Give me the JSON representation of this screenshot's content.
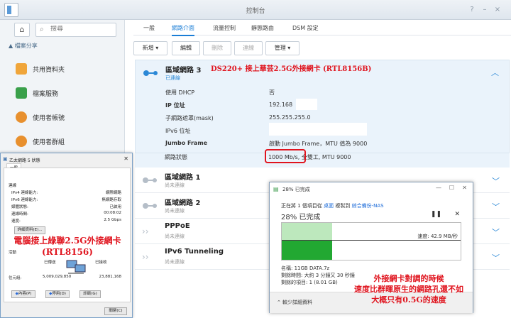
{
  "window": {
    "title": "控制台"
  },
  "sidebar": {
    "search_placeholder": "搜尋",
    "section_label": "檔案分享",
    "items": [
      {
        "label": "共用資料夾",
        "icon": "shared-folder-icon"
      },
      {
        "label": "檔案服務",
        "icon": "file-services-icon"
      },
      {
        "label": "使用者帳號",
        "icon": "user-icon"
      },
      {
        "label": "使用者群組",
        "icon": "group-icon"
      }
    ]
  },
  "tabs": [
    "一般",
    "網路介面",
    "流量控制",
    "靜態路由",
    "DSM 設定"
  ],
  "toolbar": {
    "new": "新增",
    "edit": "編輯",
    "delete": "刪除",
    "connect": "連線",
    "manage": "管理"
  },
  "lan3": {
    "name": "區域網路 3",
    "status": "已連線",
    "annotation": "DS220+ 接上華芸2.5G外接網卡 (RTL8156B)",
    "rows": [
      {
        "label": "使用 DHCP",
        "value": "否"
      },
      {
        "label": "IP 位址",
        "value": "192.168"
      },
      {
        "label": "子網路遮罩(mask)",
        "value": "255.255.255.0"
      },
      {
        "label": "IPv6 位址",
        "value": ""
      },
      {
        "label": "Jumbo Frame",
        "value": "啟動 Jumbo Frame，MTU 值為 9000"
      },
      {
        "label": "網路狀態",
        "value": "1000 Mb/s, 全雙工, MTU 9000"
      }
    ]
  },
  "interfaces": [
    {
      "name": "區域網路 1",
      "status": "尚未連線"
    },
    {
      "name": "區域網路 2",
      "status": "尚未連線"
    },
    {
      "name": "PPPoE",
      "status": "尚未連線"
    },
    {
      "name": "IPv6 Tunneling",
      "status": "尚未連線"
    }
  ],
  "eth_dialog": {
    "title": "乙太網路 5 狀態",
    "tab": "一般",
    "section_conn": "連線",
    "rows": [
      {
        "label": "IPv4 連線能力:",
        "value": "網際網路"
      },
      {
        "label": "IPv6 連線能力:",
        "value": "無網路存取"
      },
      {
        "label": "媒體狀態:",
        "value": "已啟用"
      },
      {
        "label": "連線時間:",
        "value": "00:08:02"
      },
      {
        "label": "速度:",
        "value": "2.5 Gbps"
      }
    ],
    "details_button": "詳細資料(E)...",
    "section_activity": "活動",
    "sent_label": "已傳送",
    "received_label": "已接收",
    "bytes_label": "位元組:",
    "bytes_sent": "5,009,029,850",
    "bytes_received": "23,881,168",
    "properties_button": "內容(P)",
    "disable_button": "停用(D)",
    "diagnose_button": "診斷(G)",
    "close_button": "關閉(C)",
    "annotation_line1": "電腦接上綠聯2.5G外接網卡",
    "annotation_line2": "(RTL8156)"
  },
  "copy_dialog": {
    "title": "28% 已完成",
    "copy_line_prefix": "正在將 1 個項目從",
    "copy_source": "桌面",
    "copy_mid": "複製到",
    "copy_dest": "綜合備份-NAS",
    "percent_text": "28% 已完成",
    "speed": "速度: 42.9 MB/秒",
    "progress": 0.28,
    "name_line": "名稱: 11GB DATA.7z",
    "time_left": "剩餘時間: 大約 3 分鐘又 30 秒鐘",
    "items_left": "剩餘的項目: 1 (8.01 GB)",
    "less_details": "較少詳細資料",
    "annotation_line1": "外接網卡對調的時候",
    "annotation_line2": "速度比群暉原生的網路孔還不如",
    "annotation_line3": "大概只有0.5G的速度"
  }
}
